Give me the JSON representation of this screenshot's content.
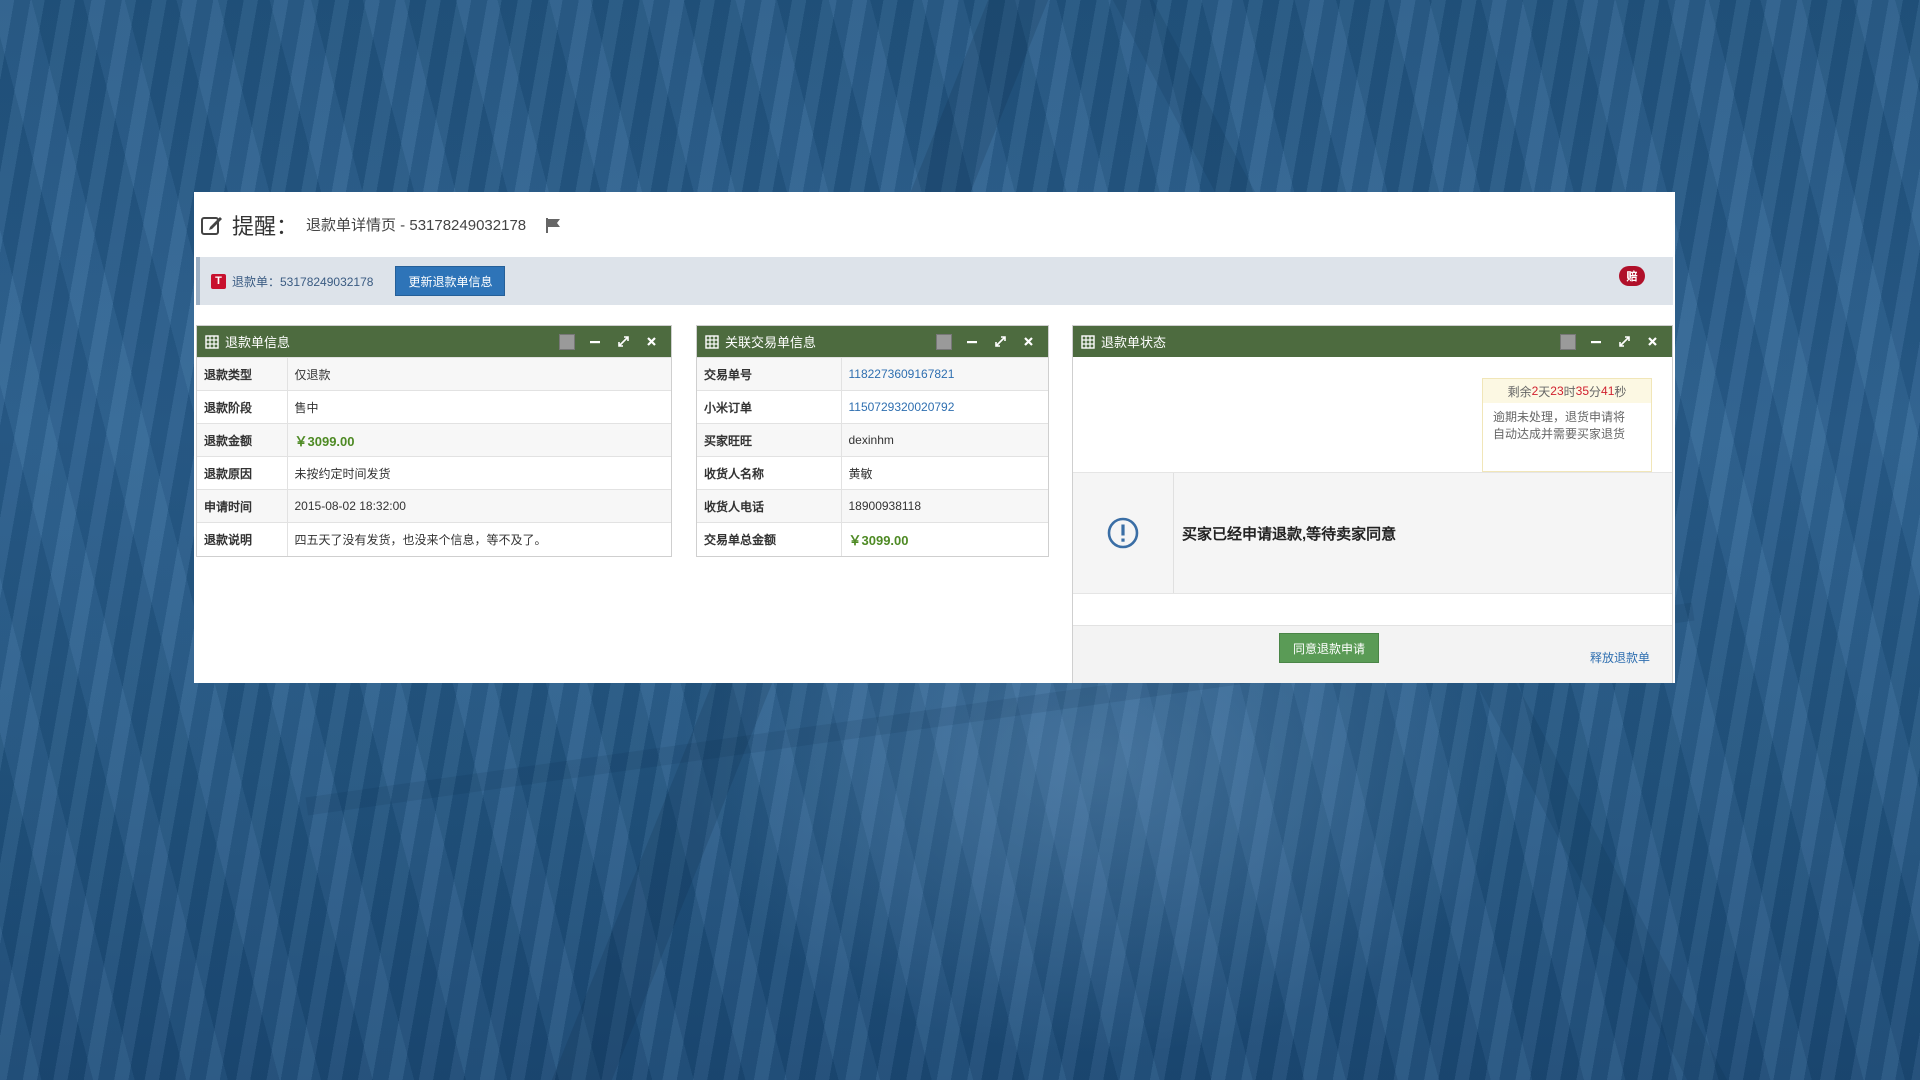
{
  "header": {
    "title": "提醒：",
    "subtitle": "退款单详情页 - 53178249032178"
  },
  "info_bar": {
    "badge": "T",
    "refund_label": "退款单：53178249032178",
    "update_button": "更新退款单信息",
    "pay_badge": "赔"
  },
  "panels": {
    "refund_info": {
      "title": "退款单信息",
      "rows": [
        {
          "k": "退款类型",
          "v": "仅退款"
        },
        {
          "k": "退款阶段",
          "v": "售中"
        },
        {
          "k": "退款金额",
          "v": "￥3099.00"
        },
        {
          "k": "退款原因",
          "v": "未按约定时间发货"
        },
        {
          "k": "申请时间",
          "v": "2015-08-02 18:32:00"
        },
        {
          "k": "退款说明",
          "v": "四五天了没有发货，也没来个信息，等不及了。"
        }
      ]
    },
    "trade_info": {
      "title": "关联交易单信息",
      "rows": [
        {
          "k": "交易单号",
          "v": "1182273609167821"
        },
        {
          "k": "小米订单",
          "v": "1150729320020792"
        },
        {
          "k": "买家旺旺",
          "v": "dexinhm"
        },
        {
          "k": "收货人名称",
          "v": "黄敏"
        },
        {
          "k": "收货人电话",
          "v": "18900938118"
        },
        {
          "k": "交易单总金额",
          "v": "￥3099.00"
        }
      ]
    },
    "status": {
      "title": "退款单状态",
      "countdown": {
        "prefix": "剩余 ",
        "days": "2",
        "days_unit": "天",
        "hours": "23",
        "hours_unit": "时",
        "minutes": "35",
        "minutes_unit": "分",
        "seconds": "41",
        "seconds_unit": "秒",
        "msg_line1": "逾期未处理，退货申请将",
        "msg_line2": "自动达成并需要买家退货"
      },
      "status_text": "买家已经申请退款,等待卖家同意",
      "agree_button": "同意退款申请",
      "release_link": "释放退款单"
    }
  },
  "colors": {
    "panel_header": "#4d6b3f",
    "primary_button": "#2e74b8",
    "success_button": "#5a9b56",
    "money": "#4e8a24",
    "countdown_highlight": "#d0202e"
  }
}
